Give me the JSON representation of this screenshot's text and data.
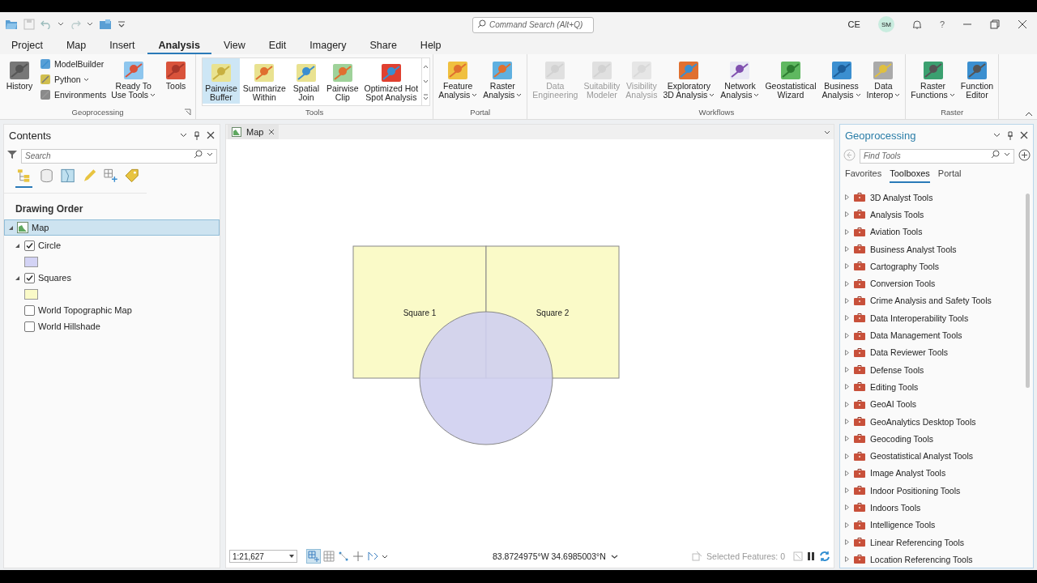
{
  "command_search": {
    "placeholder": "Command Search (Alt+Q)"
  },
  "account": {
    "initials": "CE",
    "avatar": "SM",
    "help": "?"
  },
  "menu_tabs": [
    {
      "label": "Project",
      "selected": false
    },
    {
      "label": "Map",
      "selected": false
    },
    {
      "label": "Insert",
      "selected": false
    },
    {
      "label": "Analysis",
      "selected": true
    },
    {
      "label": "View",
      "selected": false
    },
    {
      "label": "Edit",
      "selected": false
    },
    {
      "label": "Imagery",
      "selected": false
    },
    {
      "label": "Share",
      "selected": false
    },
    {
      "label": "Help",
      "selected": false
    }
  ],
  "ribbon": [
    {
      "label": "Geoprocessing",
      "kind": "buttons",
      "dialog_launcher": true,
      "items": [
        {
          "kind": "large",
          "lines": [
            "History"
          ],
          "menu": false,
          "disabled": false
        },
        {
          "kind": "small",
          "lines": [
            "ModelBuilder"
          ],
          "menu": false,
          "disabled": false
        },
        {
          "kind": "small",
          "lines": [
            "Python"
          ],
          "menu": true,
          "disabled": false
        },
        {
          "kind": "small",
          "lines": [
            "Environments"
          ],
          "menu": false,
          "disabled": false
        },
        {
          "kind": "large",
          "lines": [
            "Ready To",
            "Use Tools"
          ],
          "menu": true,
          "disabled": false
        },
        {
          "kind": "large",
          "lines": [
            "Tools"
          ],
          "menu": false,
          "disabled": false
        }
      ]
    },
    {
      "label": "Tools",
      "kind": "gallery",
      "dialog_launcher": false,
      "items": [
        {
          "kind": "large",
          "lines": [
            "Pairwise",
            "Buffer"
          ],
          "menu": false,
          "disabled": false,
          "selected": true
        },
        {
          "kind": "large",
          "lines": [
            "Summarize",
            "Within"
          ],
          "menu": false,
          "disabled": false,
          "selected": false
        },
        {
          "kind": "large",
          "lines": [
            "Spatial",
            "Join"
          ],
          "menu": false,
          "disabled": false,
          "selected": false
        },
        {
          "kind": "large",
          "lines": [
            "Pairwise",
            "Clip"
          ],
          "menu": false,
          "disabled": false,
          "selected": false
        },
        {
          "kind": "large",
          "lines": [
            "Optimized Hot",
            "Spot Analysis"
          ],
          "menu": false,
          "disabled": false,
          "selected": false
        }
      ]
    },
    {
      "label": "Portal",
      "kind": "buttons",
      "dialog_launcher": false,
      "items": [
        {
          "kind": "large",
          "lines": [
            "Feature",
            "Analysis"
          ],
          "menu": true,
          "disabled": false
        },
        {
          "kind": "large",
          "lines": [
            "Raster",
            "Analysis"
          ],
          "menu": true,
          "disabled": false
        }
      ]
    },
    {
      "label": "Workflows",
      "kind": "buttons",
      "dialog_launcher": false,
      "items": [
        {
          "kind": "large",
          "lines": [
            "Data",
            "Engineering"
          ],
          "menu": false,
          "disabled": true
        },
        {
          "kind": "large",
          "lines": [
            "Suitability",
            "Modeler"
          ],
          "menu": false,
          "disabled": true
        },
        {
          "kind": "large",
          "lines": [
            "Visibility",
            "Analysis"
          ],
          "menu": false,
          "disabled": true
        },
        {
          "kind": "large",
          "lines": [
            "Exploratory",
            "3D Analysis"
          ],
          "menu": true,
          "disabled": false
        },
        {
          "kind": "large",
          "lines": [
            "Network",
            "Analysis"
          ],
          "menu": true,
          "disabled": false
        },
        {
          "kind": "large",
          "lines": [
            "Geostatistical",
            "Wizard"
          ],
          "menu": false,
          "disabled": false
        },
        {
          "kind": "large",
          "lines": [
            "Business",
            "Analysis"
          ],
          "menu": true,
          "disabled": false
        },
        {
          "kind": "large",
          "lines": [
            "Data",
            "Interop"
          ],
          "menu": true,
          "disabled": false
        }
      ]
    },
    {
      "label": "Raster",
      "kind": "buttons",
      "dialog_launcher": false,
      "items": [
        {
          "kind": "large",
          "lines": [
            "Raster",
            "Functions"
          ],
          "menu": true,
          "disabled": false
        },
        {
          "kind": "large",
          "lines": [
            "Function",
            "Editor"
          ],
          "menu": false,
          "disabled": false
        }
      ]
    }
  ],
  "contents": {
    "title": "Contents",
    "search": {
      "placeholder": "Search"
    },
    "heading": "Drawing Order",
    "tree": [
      {
        "label": "Map",
        "selected": true,
        "expanded": true,
        "children": [
          {
            "label": "Circle",
            "checked": true,
            "expanded": true,
            "legend": {
              "color": "#d3d3f5"
            }
          },
          {
            "label": "Squares",
            "checked": true,
            "expanded": true,
            "legend": {
              "color": "#fafac8"
            }
          },
          {
            "label": "World Topographic Map",
            "checked": false
          },
          {
            "label": "World Hillshade",
            "checked": false
          }
        ]
      }
    ]
  },
  "map_view": {
    "tab": "Map",
    "features": [
      {
        "label": "Square 1"
      },
      {
        "label": "Square 2"
      }
    ],
    "status": {
      "scale": "1:21,627",
      "coordinates": "83.8724975°W 34.6985003°N",
      "selected_features": "Selected Features: 0"
    }
  },
  "geoprocessing": {
    "title": "Geoprocessing",
    "search": {
      "placeholder": "Find Tools"
    },
    "tabs": [
      {
        "label": "Favorites",
        "selected": false
      },
      {
        "label": "Toolboxes",
        "selected": true
      },
      {
        "label": "Portal",
        "selected": false
      }
    ],
    "toolboxes": [
      "3D Analyst Tools",
      "Analysis Tools",
      "Aviation Tools",
      "Business Analyst Tools",
      "Cartography Tools",
      "Conversion Tools",
      "Crime Analysis and Safety Tools",
      "Data Interoperability Tools",
      "Data Management Tools",
      "Data Reviewer Tools",
      "Defense Tools",
      "Editing Tools",
      "GeoAI Tools",
      "GeoAnalytics Desktop Tools",
      "Geocoding Tools",
      "Geostatistical Analyst Tools",
      "Image Analyst Tools",
      "Indoor Positioning Tools",
      "Indoors Tools",
      "Intelligence Tools",
      "Linear Referencing Tools",
      "Location Referencing Tools"
    ]
  }
}
